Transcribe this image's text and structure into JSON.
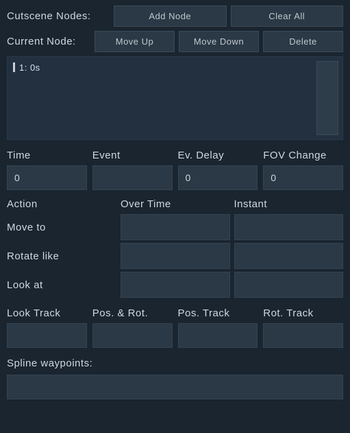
{
  "header": {
    "cutscene_nodes_label": "Cutscene Nodes:",
    "add_node_label": "Add Node",
    "clear_all_label": "Clear All",
    "current_node_label": "Current Node:",
    "move_up_label": "Move Up",
    "move_down_label": "Move Down",
    "delete_label": "Delete"
  },
  "node_list": {
    "items": [
      {
        "text": "1: 0s"
      }
    ]
  },
  "fields": {
    "time": {
      "label": "Time",
      "value": "0"
    },
    "event": {
      "label": "Event",
      "value": ""
    },
    "ev_delay": {
      "label": "Ev. Delay",
      "value": "0"
    },
    "fov_change": {
      "label": "FOV Change",
      "value": "0"
    }
  },
  "actions": {
    "action_head": "Action",
    "over_time_head": "Over Time",
    "instant_head": "Instant",
    "move_to_label": "Move to",
    "rotate_like_label": "Rotate like",
    "look_at_label": "Look at"
  },
  "tracks": {
    "look_track_label": "Look Track",
    "pos_rot_label": "Pos. & Rot.",
    "pos_track_label": "Pos. Track",
    "rot_track_label": "Rot. Track"
  },
  "spline": {
    "label": "Spline waypoints:"
  }
}
